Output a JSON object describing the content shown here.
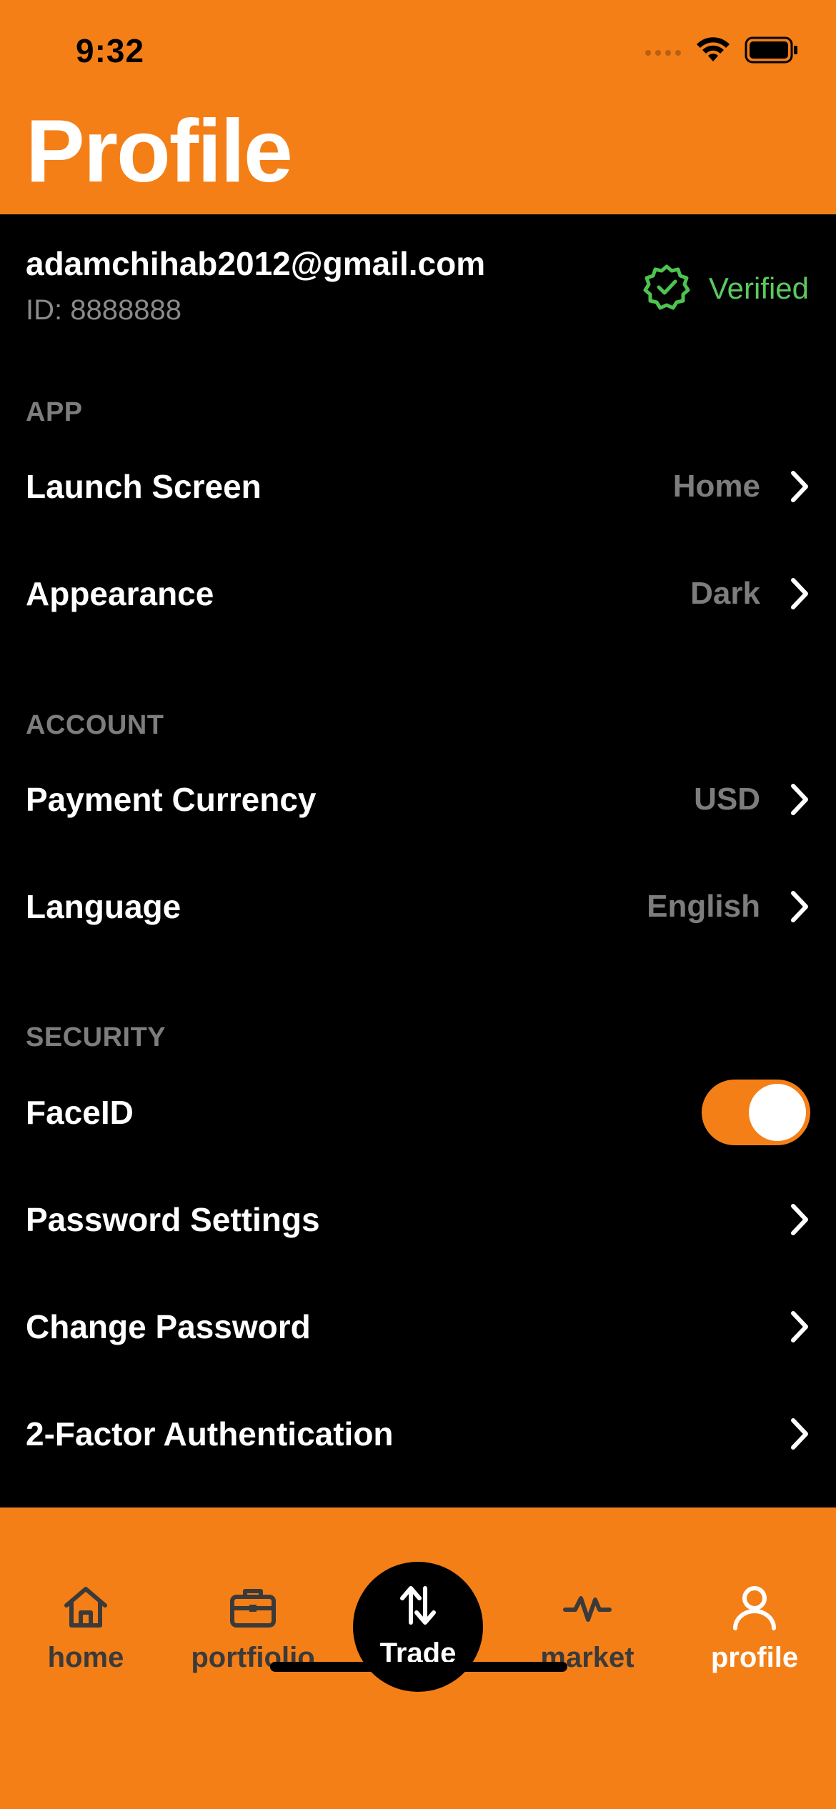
{
  "status_bar": {
    "time": "9:32"
  },
  "header": {
    "title": "Profile"
  },
  "account": {
    "email": "adamchihab2012@gmail.com",
    "id": "ID: 8888888",
    "verified_label": "Verified"
  },
  "sections": {
    "app": {
      "label": "APP",
      "rows": [
        {
          "label": "Launch Screen",
          "value": "Home"
        },
        {
          "label": "Appearance",
          "value": "Dark"
        }
      ]
    },
    "account": {
      "label": "ACCOUNT",
      "rows": [
        {
          "label": "Payment Currency",
          "value": "USD"
        },
        {
          "label": "Language",
          "value": "English"
        }
      ]
    },
    "security": {
      "label": "SECURITY",
      "faceid": {
        "label": "FaceID",
        "enabled": true
      },
      "rows": [
        {
          "label": "Password Settings"
        },
        {
          "label": "Change Password"
        },
        {
          "label": "2-Factor Authentication"
        }
      ]
    }
  },
  "tabbar": {
    "home": "home",
    "portfolio": "portfiolio",
    "trade": "Trade",
    "market": "market",
    "profile": "profile",
    "active": "profile"
  },
  "colors": {
    "accent": "#F47F17",
    "background": "#000000",
    "verified": "#5CC95E",
    "muted": "#7D7D7D"
  }
}
